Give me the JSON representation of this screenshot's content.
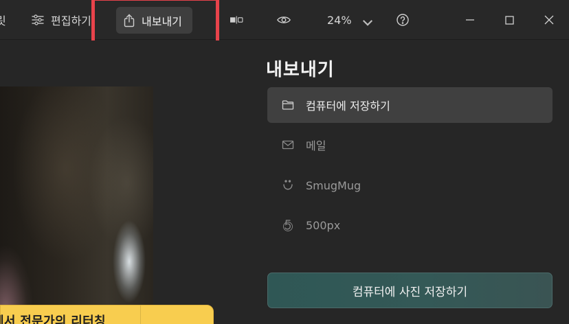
{
  "toolbar": {
    "prev_tail": "릿",
    "edit_label": "편집하기",
    "export_label": "내보내기",
    "zoom_value": "24%",
    "icons": {
      "edit": "sliders-icon",
      "export": "share-upload-icon",
      "compare": "compare-icon",
      "view": "eye-icon",
      "zoom_caret": "chevron-down-icon",
      "help": "help-circle-icon",
      "minimize": "minimize-icon",
      "maximize": "maximize-icon",
      "close": "close-icon"
    },
    "highlight_color": "#e8434b"
  },
  "promo": {
    "text": "에서 전문가의 리터칭",
    "color": "#f8cd4f"
  },
  "panel": {
    "title": "내보내기",
    "options": [
      {
        "label": "컴퓨터에 저장하기",
        "icon": "folder-icon",
        "selected": true
      },
      {
        "label": "메일",
        "icon": "mail-icon",
        "selected": false
      },
      {
        "label": "SmugMug",
        "icon": "smugmug-icon",
        "selected": false
      },
      {
        "label": "500px",
        "icon": "500px-icon",
        "selected": false
      }
    ],
    "save_button_label": "컴퓨터에 사진 저장하기",
    "accent_color": "#345957"
  }
}
